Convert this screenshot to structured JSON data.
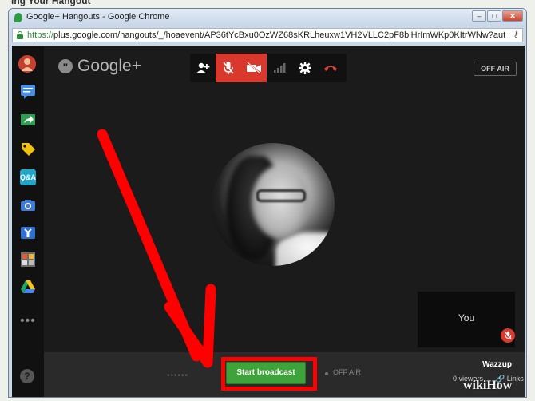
{
  "page_heading": "ing Your Hangout",
  "window": {
    "title": "Google+ Hangouts - Google Chrome",
    "controls": {
      "minimize": "–",
      "maximize": "□",
      "close": "✕"
    }
  },
  "address_bar": {
    "scheme": "https://",
    "url_rest": "plus.google.com/hangouts/_/hoaevent/AP36tYcBxu0OzWZ68sKRLheuxw1VH2VLLC2pF8biHrImWKp0KItrWNw?authuser"
  },
  "app": {
    "logo_text": "Google+",
    "logo_mark": "\"",
    "off_air_button": "OFF AIR",
    "toolbar_icons": [
      "add-person-icon",
      "mic-muted-icon",
      "camera-off-icon",
      "signal-icon",
      "settings-icon",
      "hangup-icon"
    ],
    "left_rail_icons": [
      "avatar",
      "chat-icon",
      "screenshare-icon",
      "tag-icon",
      "qna-icon",
      "camera-icon",
      "youtube-icon",
      "apps-icon",
      "drive-icon"
    ],
    "rail_labels": {
      "qna": "Q&A"
    },
    "rail_more": "•••",
    "help": "?",
    "self_tile": {
      "label": "You"
    },
    "bottom_bar": {
      "start_broadcast": "Start broadcast",
      "progress_dots": "••••••",
      "off_air_status": "OFF AIR",
      "event_title": "Wazzup",
      "viewers": "0 viewers",
      "links": "Links"
    }
  },
  "annotation_colors": {
    "arrow": "#ff0000",
    "highlight": "#ff0000"
  },
  "watermark": "wikiHow"
}
